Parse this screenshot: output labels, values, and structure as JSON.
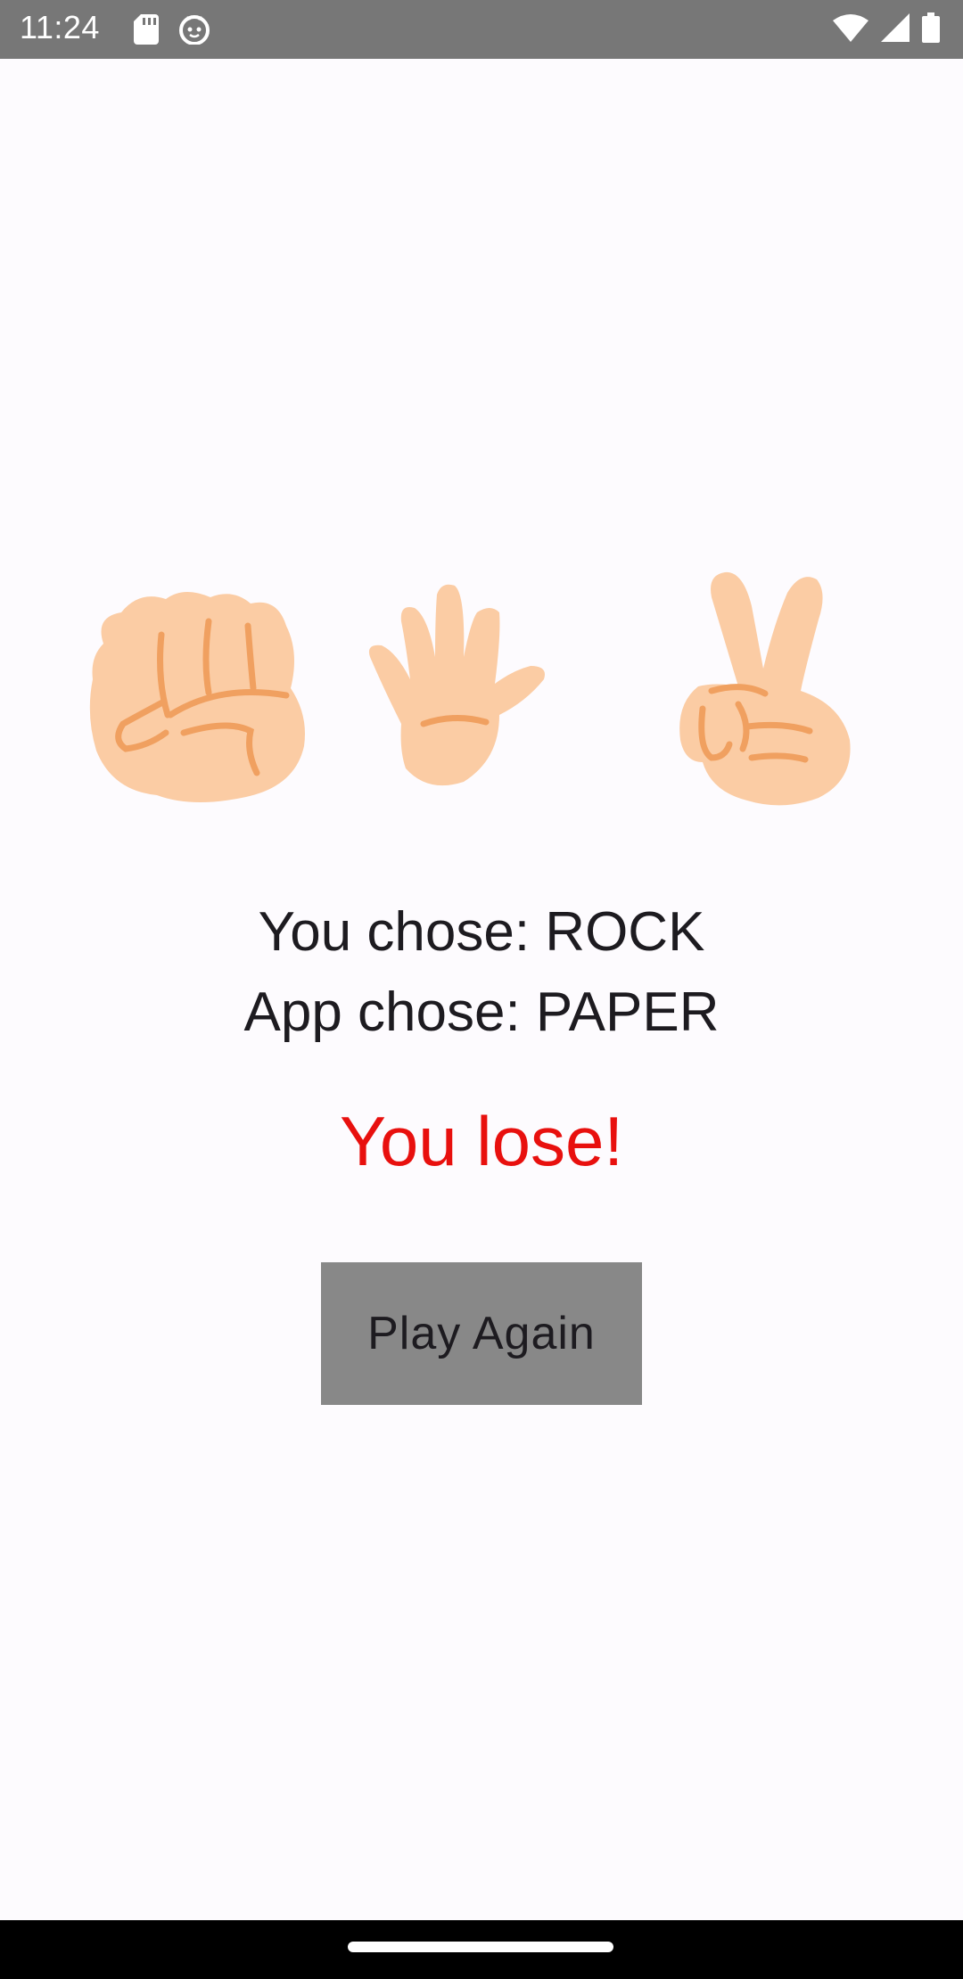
{
  "status_bar": {
    "time": "11:24",
    "left_icons": [
      "sd-card-icon",
      "cat-face-icon"
    ],
    "right_icons": [
      "wifi-icon",
      "cellular-signal-icon",
      "battery-icon"
    ]
  },
  "hands": [
    {
      "name": "rock",
      "icon": "rock-fist-icon"
    },
    {
      "name": "paper",
      "icon": "paper-open-hand-icon"
    },
    {
      "name": "scissors",
      "icon": "scissors-peace-hand-icon"
    }
  ],
  "result": {
    "you_chose": "You chose: ROCK",
    "app_chose": "App chose: PAPER",
    "outcome": "You lose!",
    "outcome_color": "#e8100e"
  },
  "play_again_button": {
    "label": "Play Again"
  },
  "colors": {
    "background": "#fdfbfe",
    "status_bar": "#777777",
    "button": "#888888",
    "skin": "#fbcca4",
    "skin_line": "#f0a060"
  }
}
